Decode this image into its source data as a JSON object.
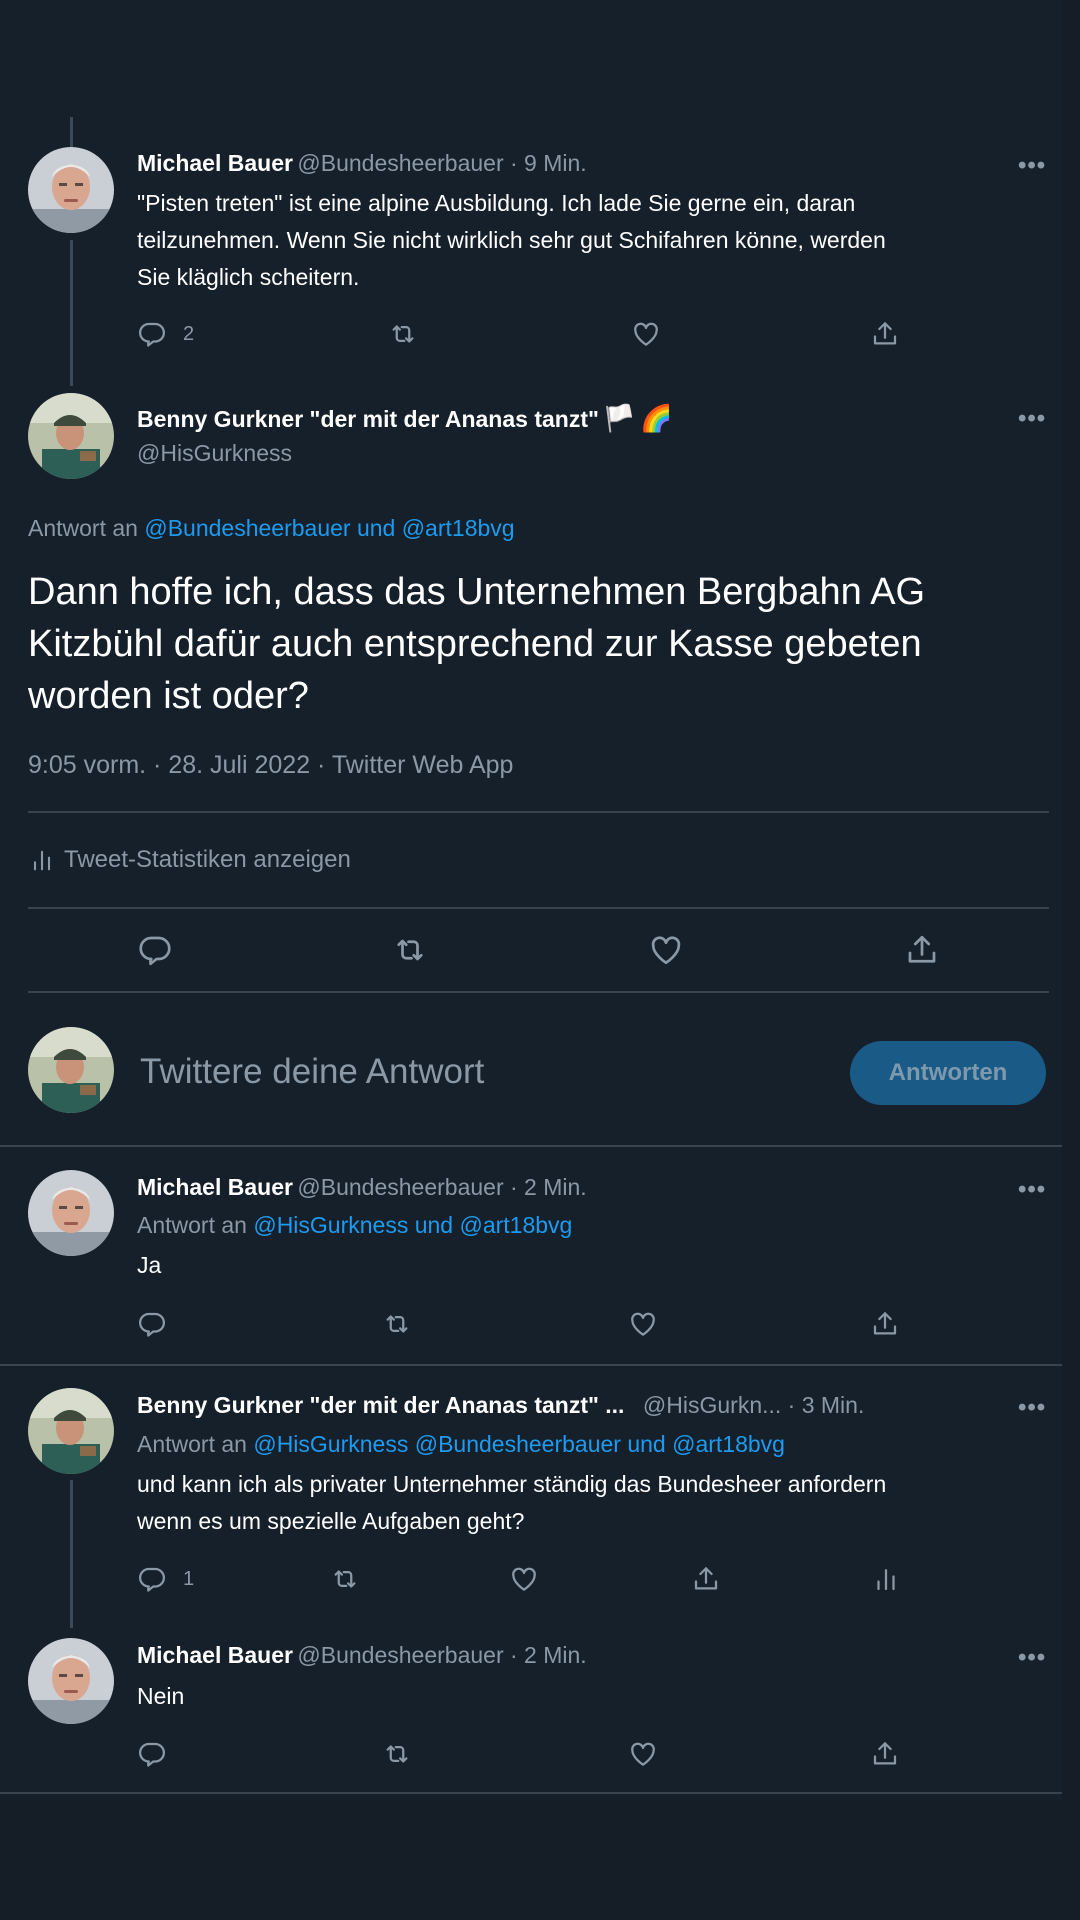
{
  "colors": {
    "background": "#15202b",
    "link": "#1d9bf0",
    "muted": "#8b98a5",
    "button": "#1a5a86"
  },
  "tweet1": {
    "name": "Michael Bauer",
    "meta": "@Bundesheerbauer · 9 Min.",
    "lines": [
      "\"Pisten treten\" ist eine alpine Ausbildung. Ich lade Sie gerne ein, daran",
      "teilzunehmen. Wenn Sie nicht wirklich sehr gut Schifahren könne, werden",
      "Sie kläglich scheitern."
    ],
    "reply_count": "2",
    "more": "•••"
  },
  "main": {
    "name": "Benny Gurkner \"der mit der Ananas tanzt\"",
    "handle": "@HisGurkness",
    "emoji_flag": "🏳️",
    "emoji_rainbow": "🌈",
    "reply_to_prefix": "Antwort an",
    "reply_to_users": "@Bundesheerbauer und @art18bvg",
    "text_lines": [
      "Dann hoffe ich, dass das Unternehmen Bergbahn AG",
      "Kitzbühl dafür auch entsprechend zur Kasse gebeten",
      "worden ist oder?"
    ],
    "timestamp": "9:05 vorm. · 28. Juli 2022 · Twitter Web App",
    "stats_label": "Tweet-Statistiken anzeigen",
    "more": "•••"
  },
  "composer": {
    "placeholder": "Twittere deine Antwort",
    "button_label": "Antworten"
  },
  "reply1": {
    "name": "Michael Bauer",
    "meta": "@Bundesheerbauer · 2 Min.",
    "reply_to_prefix": "Antwort an",
    "reply_to_users": "@HisGurkness und @art18bvg",
    "text": "Ja",
    "more": "•••"
  },
  "reply2": {
    "name": "Benny Gurkner \"der mit der Ananas tanzt\" ...",
    "meta": "@HisGurkn... · 3 Min.",
    "reply_to_prefix": "Antwort an",
    "reply_to_users": "@HisGurkness @Bundesheerbauer und @art18bvg",
    "lines": [
      "und kann ich als privater Unternehmer ständig das Bundesheer anfordern",
      "wenn es um spezielle Aufgaben geht?"
    ],
    "reply_count": "1",
    "more": "•••"
  },
  "reply3": {
    "name": "Michael Bauer",
    "meta": "@Bundesheerbauer · 2 Min.",
    "text": "Nein",
    "more": "•••"
  }
}
